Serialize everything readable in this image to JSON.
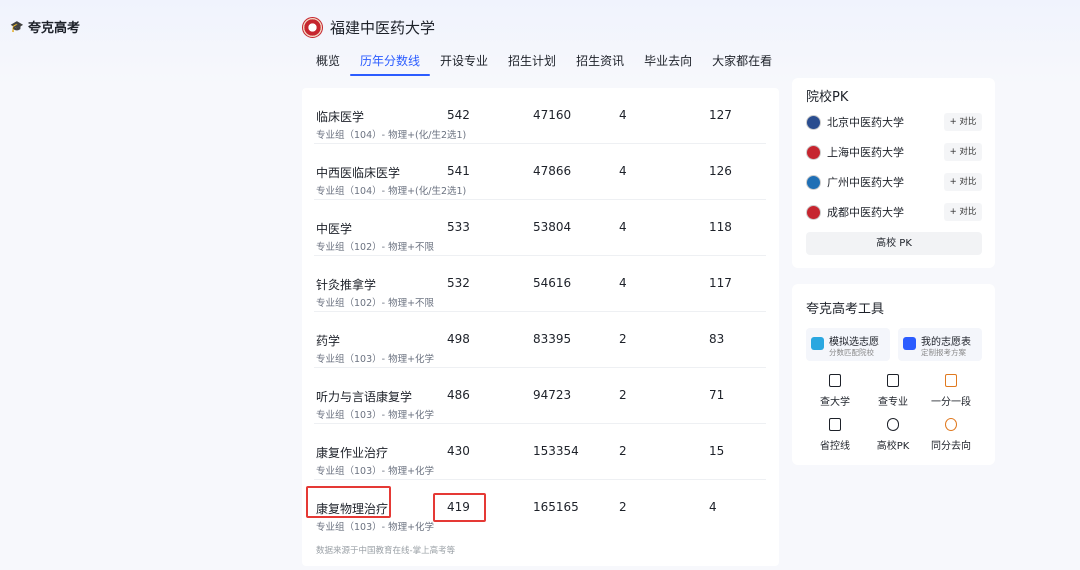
{
  "app": {
    "logo_text": "夸克高考",
    "logo_icon": "graduation-cap-icon"
  },
  "university": {
    "name": "福建中医药大学",
    "emblem_icon": "university-emblem-icon"
  },
  "tabs": [
    {
      "label": "概览",
      "active": false
    },
    {
      "label": "历年分数线",
      "active": true
    },
    {
      "label": "开设专业",
      "active": false
    },
    {
      "label": "招生计划",
      "active": false
    },
    {
      "label": "招生资讯",
      "active": false
    },
    {
      "label": "毕业去向",
      "active": false
    },
    {
      "label": "大家都在看",
      "active": false
    }
  ],
  "score_table": {
    "rows": [
      {
        "name": "临床医学",
        "sub": "专业组（104）- 物理+(化/生2选1)",
        "score": "542",
        "rank": "47160",
        "years": "4",
        "plan": "127"
      },
      {
        "name": "中西医临床医学",
        "sub": "专业组（104）- 物理+(化/生2选1)",
        "score": "541",
        "rank": "47866",
        "years": "4",
        "plan": "126"
      },
      {
        "name": "中医学",
        "sub": "专业组（102）- 物理+不限",
        "score": "533",
        "rank": "53804",
        "years": "4",
        "plan": "118"
      },
      {
        "name": "针灸推拿学",
        "sub": "专业组（102）- 物理+不限",
        "score": "532",
        "rank": "54616",
        "years": "4",
        "plan": "117"
      },
      {
        "name": "药学",
        "sub": "专业组（103）- 物理+化学",
        "score": "498",
        "rank": "83395",
        "years": "2",
        "plan": "83"
      },
      {
        "name": "听力与言语康复学",
        "sub": "专业组（103）- 物理+化学",
        "score": "486",
        "rank": "94723",
        "years": "2",
        "plan": "71"
      },
      {
        "name": "康复作业治疗",
        "sub": "专业组（103）- 物理+化学",
        "score": "430",
        "rank": "153354",
        "years": "2",
        "plan": "15"
      },
      {
        "name": "康复物理治疗",
        "sub": "专业组（103）- 物理+化学",
        "score": "419",
        "rank": "165165",
        "years": "2",
        "plan": "4"
      }
    ],
    "source": "数据来源于中国教育在线-掌上高考等",
    "highlight_color": "#e53935"
  },
  "pk": {
    "title": "院校PK",
    "compare_label": "+ 对比",
    "items": [
      {
        "name": "北京中医药大学",
        "color": "#2a4d8f"
      },
      {
        "name": "上海中医药大学",
        "color": "#c6252f"
      },
      {
        "name": "广州中医药大学",
        "color": "#1f6fb5"
      },
      {
        "name": "成都中医药大学",
        "color": "#c6252f"
      }
    ],
    "button_label": "高校 PK"
  },
  "tools": {
    "title": "夸克高考工具",
    "big": [
      {
        "title": "模拟选志愿",
        "sub": "分数匹配院校",
        "icon": "cube-icon",
        "color": "#2aa7e0"
      },
      {
        "title": "我的志愿表",
        "sub": "定制报考方案",
        "icon": "plus-square-icon",
        "color": "#2b5cff"
      }
    ],
    "small": [
      {
        "label": "查大学",
        "icon": "building-icon"
      },
      {
        "label": "查专业",
        "icon": "book-icon"
      },
      {
        "label": "一分一段",
        "icon": "score-icon"
      },
      {
        "label": "省控线",
        "icon": "monitor-icon"
      },
      {
        "label": "高校PK",
        "icon": "shield-icon"
      },
      {
        "label": "同分去向",
        "icon": "location-icon"
      }
    ]
  },
  "accent_color": "#2b5cff"
}
